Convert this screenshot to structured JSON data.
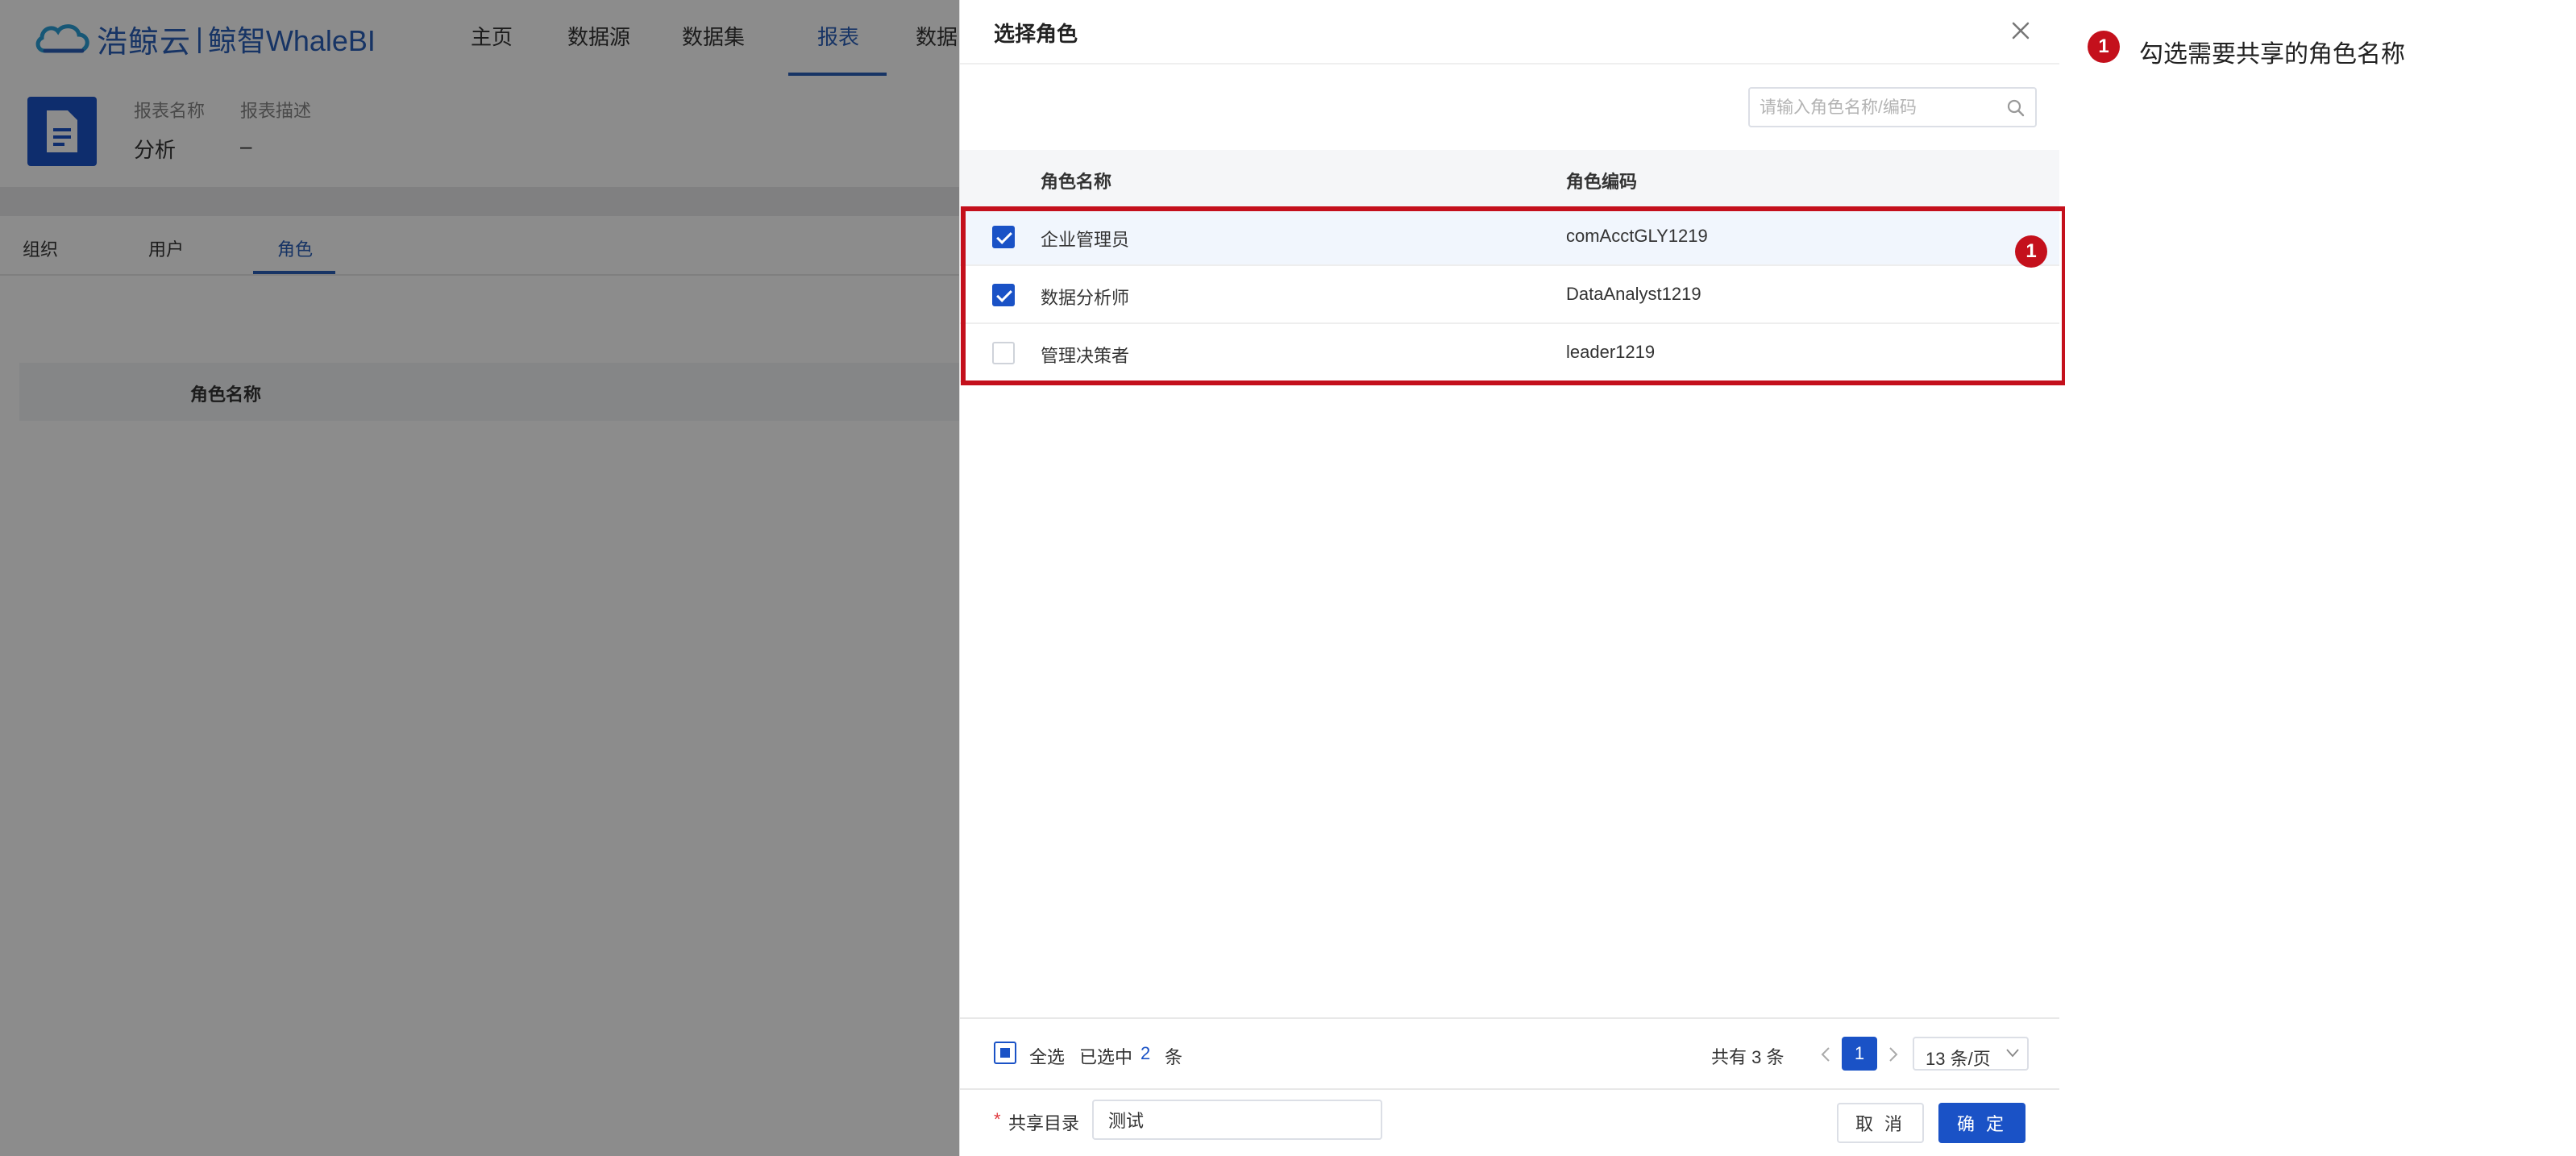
{
  "app": {
    "logo_text": "浩鲸云",
    "logo_separator": "|",
    "logo_subtitle": "鲸智WhaleBI",
    "nav": [
      "主页",
      "数据源",
      "数据集",
      "报表",
      "数据"
    ],
    "nav_active_index": 3,
    "report": {
      "name_label": "报表名称",
      "name_value": "分析",
      "desc_label": "报表描述",
      "desc_value": "–"
    },
    "subtabs": [
      "组织",
      "用户",
      "角色"
    ],
    "subtab_active_index": 2,
    "bg_table_header": "角色名称"
  },
  "drawer": {
    "title": "选择角色",
    "search_placeholder": "请输入角色名称/编码",
    "columns": {
      "name": "角色名称",
      "code": "角色编码"
    },
    "rows": [
      {
        "name": "企业管理员",
        "code": "comAcctGLY1219",
        "checked": true
      },
      {
        "name": "数据分析师",
        "code": "DataAnalyst1219",
        "checked": true
      },
      {
        "name": "管理决策者",
        "code": "leader1219",
        "checked": false
      }
    ],
    "footer": {
      "select_all": "全选",
      "selected_prefix": "已选中",
      "selected_count": "2",
      "selected_suffix": "条",
      "total": "共有 3 条",
      "current_page": "1",
      "page_size": "13 条/页"
    },
    "form": {
      "required_mark": "*",
      "share_dir_label": "共享目录",
      "share_dir_value": "测试",
      "cancel": "取 消",
      "ok": "确 定"
    }
  },
  "annotation": {
    "badge": "1",
    "text": "勾选需要共享的角色名称",
    "color": "#c4101c"
  },
  "colors": {
    "primary": "#1a52c6",
    "brand": "#2a5fb9",
    "annotation_red": "#c4101c"
  }
}
